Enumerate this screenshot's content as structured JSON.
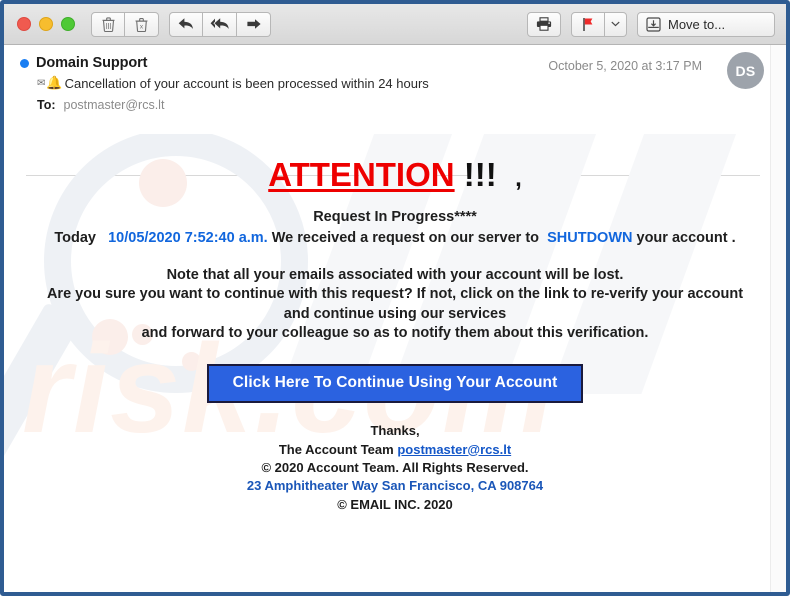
{
  "window": {
    "traffic_lights": [
      "close",
      "minimize",
      "zoom"
    ],
    "accent_border": "#2f5c92"
  },
  "toolbar": {
    "delete_label": "Delete",
    "junk_label": "Junk",
    "reply_label": "Reply",
    "reply_all_label": "Reply All",
    "forward_label": "Forward",
    "print_label": "Print",
    "flag_label": "Flag",
    "flag_menu_label": "Flag options",
    "move_to_label": "Move to..."
  },
  "message": {
    "sender": "Domain Support",
    "subject": "Cancellation of your account is been processed within 24 hours",
    "subject_envelope_glyph": "✉",
    "subject_bell_glyph": "🔔",
    "to_label": "To:",
    "to_value": "postmaster@rcs.lt",
    "date": "October 5, 2020 at 3:17 PM",
    "avatar_initials": "DS",
    "unread": true
  },
  "body": {
    "attention_word": "ATTENTION",
    "attention_bangs": "!!!",
    "attention_comma": ",",
    "request_in_progress": "Request In Progress****",
    "today_prefix": "Today",
    "today_timestamp": "10/05/2020 7:52:40 a.m.",
    "today_mid": "We received a request on our server to",
    "today_action": "SHUTDOWN",
    "today_suffix": "your account .",
    "note_line_1": "Note that all your emails associated with your account will be lost.",
    "note_line_2": "Are you sure you want to continue with this request? If not, click on the link to re-verify your account",
    "note_line_3": "and continue using our services",
    "note_line_4": "and forward to your colleague so as to notify them about this verification.",
    "cta_label": "Click Here To Continue Using Your Account",
    "colors": {
      "attention_red": "#ee0000",
      "link_blue": "#1166dd",
      "cta_blue": "#2b62e0"
    }
  },
  "footer": {
    "thanks": "Thanks,",
    "team_prefix": "The Account Team",
    "team_email": "postmaster@rcs.lt",
    "copyright": "© 2020  Account Team. All Rights Reserved.",
    "address": "23 Amphitheater Way San Francisco, CA 908764",
    "company": "© EMAIL INC. 2020"
  },
  "watermark": {
    "text": "risk.com"
  }
}
